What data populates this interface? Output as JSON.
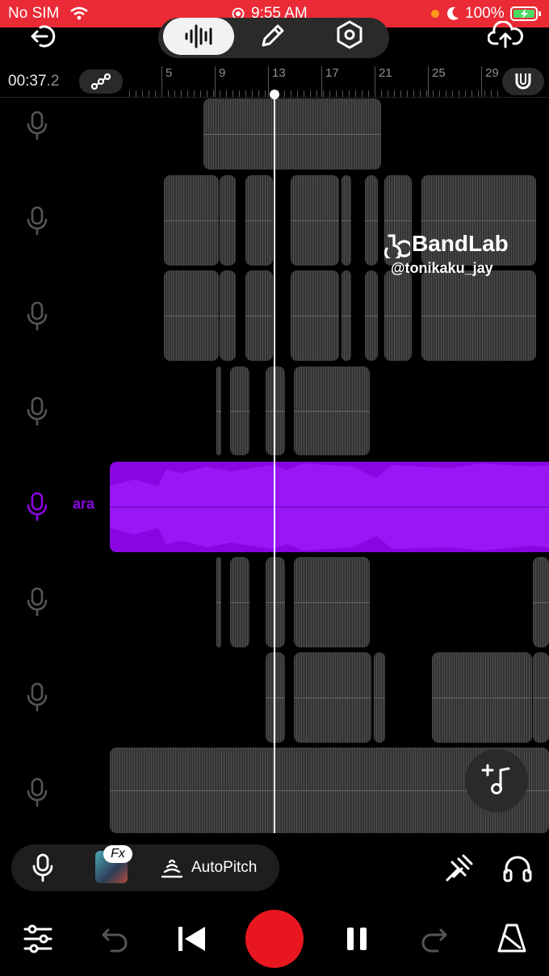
{
  "status_bar": {
    "carrier": "No SIM",
    "time": "9:55 AM",
    "battery": "100%",
    "color": "#ea2a35"
  },
  "toolbar": {
    "icons": [
      "exit-icon",
      "waveform-icon",
      "pen-icon",
      "settings-icon",
      "cloud-upload-icon"
    ]
  },
  "timeline": {
    "position_main": "00:37",
    "position_frac": ".2",
    "ruler_labels": [
      "5",
      "9",
      "13",
      "17",
      "21",
      "25",
      "29"
    ]
  },
  "tracks": {
    "active_label": "ara",
    "active_color": "#8a06e0",
    "count": 8
  },
  "watermark": {
    "brand": "BandLab",
    "handle": "@tonikaku_jay"
  },
  "bottom_bar": {
    "fx_badge": "Fx",
    "autopitch_label": "AutoPitch"
  }
}
